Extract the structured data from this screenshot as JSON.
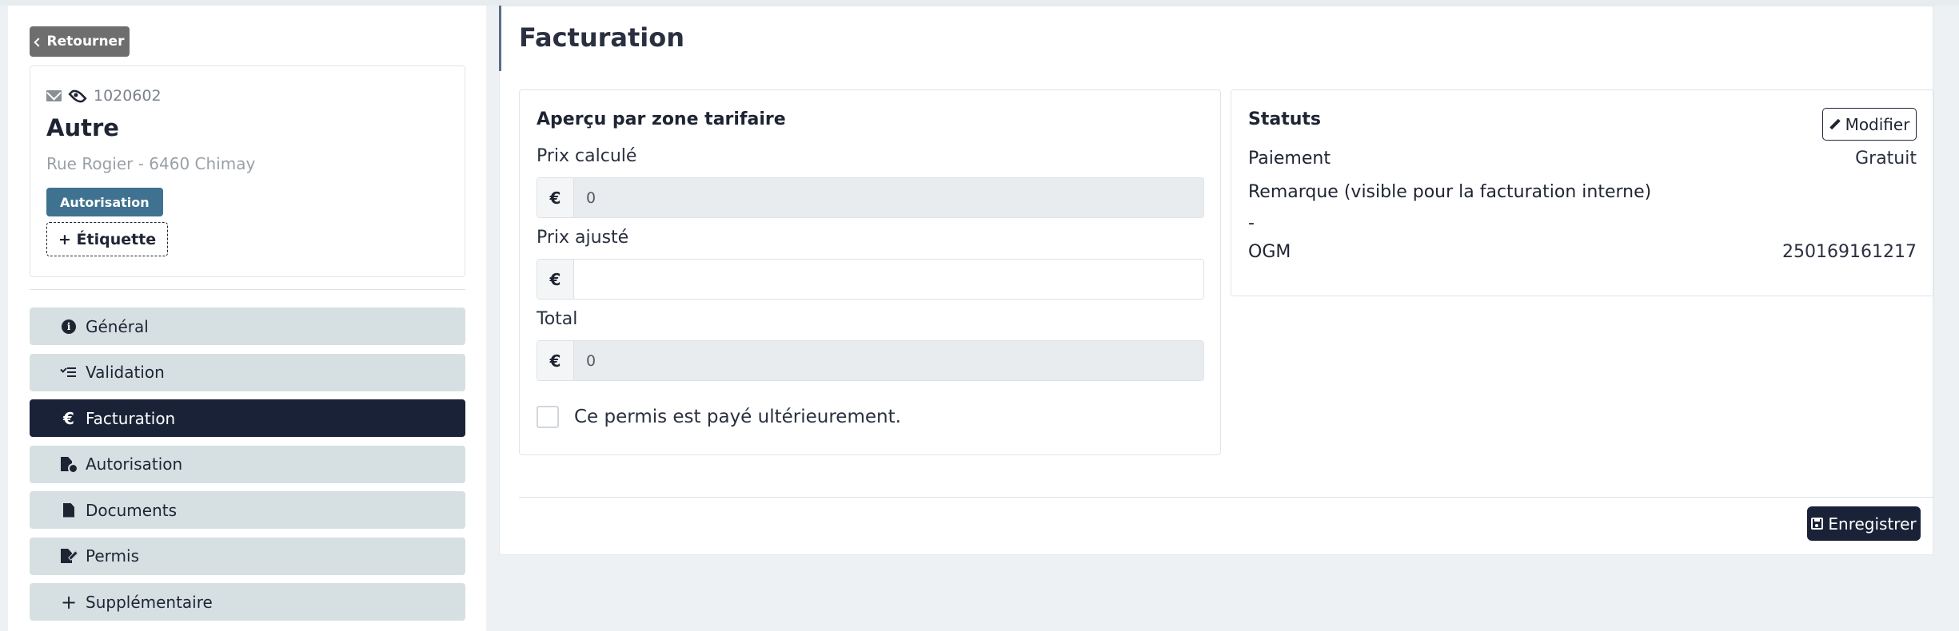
{
  "sidebar": {
    "back_label": "Retourner",
    "record": {
      "reference": "1020602",
      "title": "Autre",
      "address": "Rue Rogier - 6460 Chimay",
      "badge": "Autorisation",
      "tag_button": "+ Étiquette"
    },
    "nav": [
      {
        "label": "Général",
        "icon": "info-circle-icon"
      },
      {
        "label": "Validation",
        "icon": "list-check-icon"
      },
      {
        "label": "Facturation",
        "icon": "euro-icon",
        "active": true
      },
      {
        "label": "Autorisation",
        "icon": "file-clock-icon"
      },
      {
        "label": "Documents",
        "icon": "file-icon"
      },
      {
        "label": "Permis",
        "icon": "file-signature-icon"
      },
      {
        "label": "Supplémentaire",
        "icon": "plus-icon"
      }
    ]
  },
  "main": {
    "title": "Facturation",
    "pricing": {
      "title": "Aperçu par zone tarifaire",
      "currency": "€",
      "computed_label": "Prix calculé",
      "computed_value": "0",
      "adjusted_label": "Prix ajusté",
      "adjusted_value": "",
      "total_label": "Total",
      "total_value": "0",
      "deferred_label": "Ce permis est payé ultérieurement.",
      "deferred_checked": false
    },
    "status": {
      "title": "Statuts",
      "modify_label": "Modifier",
      "payment_label": "Paiement",
      "payment_value": "Gratuit",
      "remark_label": "Remarque (visible pour la facturation interne)",
      "remark_value": "-",
      "ogm_label": "OGM",
      "ogm_value": "250169161217"
    },
    "save_label": "Enregistrer"
  },
  "colors": {
    "primary_dark": "#1a2238",
    "badge": "#3e7290",
    "nav_bg": "#d6e0e3",
    "back_button": "#6e6e6e"
  }
}
